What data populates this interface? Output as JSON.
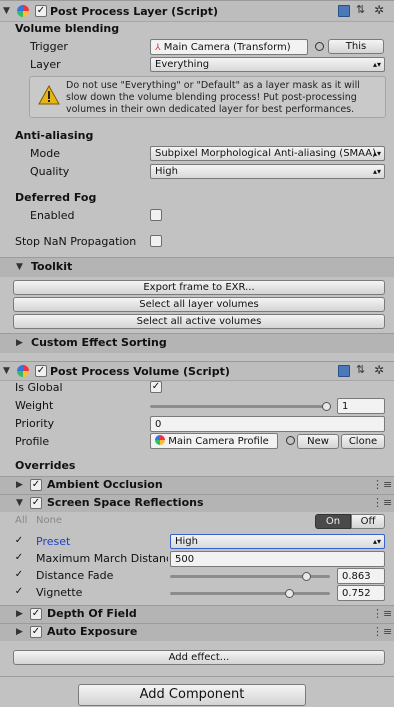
{
  "layer": {
    "title": "Post Process Layer (Script)",
    "volume_blending": "Volume blending",
    "trigger_label": "Trigger",
    "trigger_value": "Main Camera (Transform)",
    "trigger_this": "This",
    "layer_label": "Layer",
    "layer_value": "Everything",
    "warning": "Do not use \"Everything\" or \"Default\" as a layer mask as it will slow down the volume blending process! Put post-processing volumes in their own dedicated layer for best performances.",
    "anti_aliasing": "Anti-aliasing",
    "mode_label": "Mode",
    "mode_value": "Subpixel Morphological Anti-aliasing (SMAA)",
    "quality_label": "Quality",
    "quality_value": "High",
    "deferred_fog": "Deferred Fog",
    "enabled_label": "Enabled",
    "stop_nan": "Stop NaN Propagation",
    "toolkit": "Toolkit",
    "export_btn": "Export frame to EXR...",
    "select_layer_btn": "Select all layer volumes",
    "select_active_btn": "Select all active volumes",
    "custom_sorting": "Custom Effect Sorting"
  },
  "volume": {
    "title": "Post Process Volume (Script)",
    "is_global_label": "Is Global",
    "weight_label": "Weight",
    "weight_value": "1",
    "weight_fraction": 1.0,
    "priority_label": "Priority",
    "priority_value": "0",
    "profile_label": "Profile",
    "profile_value": "Main Camera Profile",
    "new_btn": "New",
    "clone_btn": "Clone",
    "overrides": "Overrides",
    "effects": [
      {
        "name": "Ambient Occlusion",
        "expanded": false
      },
      {
        "name": "Screen Space Reflections",
        "expanded": true
      },
      {
        "name": "Depth Of Field",
        "expanded": false
      },
      {
        "name": "Auto Exposure",
        "expanded": false
      }
    ],
    "all_label": "All",
    "none_label": "None",
    "on_label": "On",
    "off_label": "Off",
    "ssr": {
      "preset_label": "Preset",
      "preset_value": "High",
      "max_march_label": "Maximum March Distance",
      "max_march_value": "500",
      "distance_fade_label": "Distance Fade",
      "distance_fade_value": "0.863",
      "distance_fade_fraction": 0.863,
      "vignette_label": "Vignette",
      "vignette_value": "0.752",
      "vignette_fraction": 0.752
    },
    "add_effect_btn": "Add effect..."
  },
  "add_component_btn": "Add Component",
  "colors": {
    "background": "#c2c2c2",
    "preset_blue": "#2040c0",
    "on_active": "#4a4a4a"
  }
}
